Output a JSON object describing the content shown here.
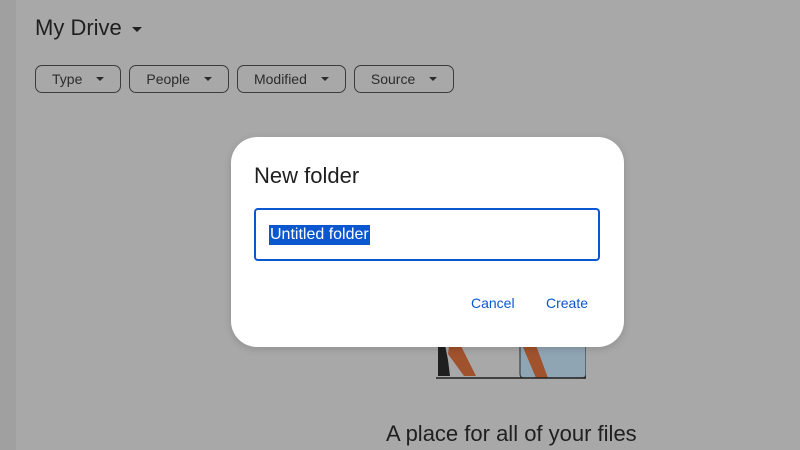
{
  "header": {
    "title": "My Drive"
  },
  "filters": [
    {
      "label": "Type"
    },
    {
      "label": "People"
    },
    {
      "label": "Modified"
    },
    {
      "label": "Source"
    }
  ],
  "empty_state": {
    "text": "A place for all of your files"
  },
  "dialog": {
    "title": "New folder",
    "input_value": "Untitled folder",
    "cancel_label": "Cancel",
    "create_label": "Create"
  },
  "colors": {
    "accent": "#0b57d0",
    "scrim": "#a8a8a8",
    "dialog_bg": "#ffffff"
  }
}
